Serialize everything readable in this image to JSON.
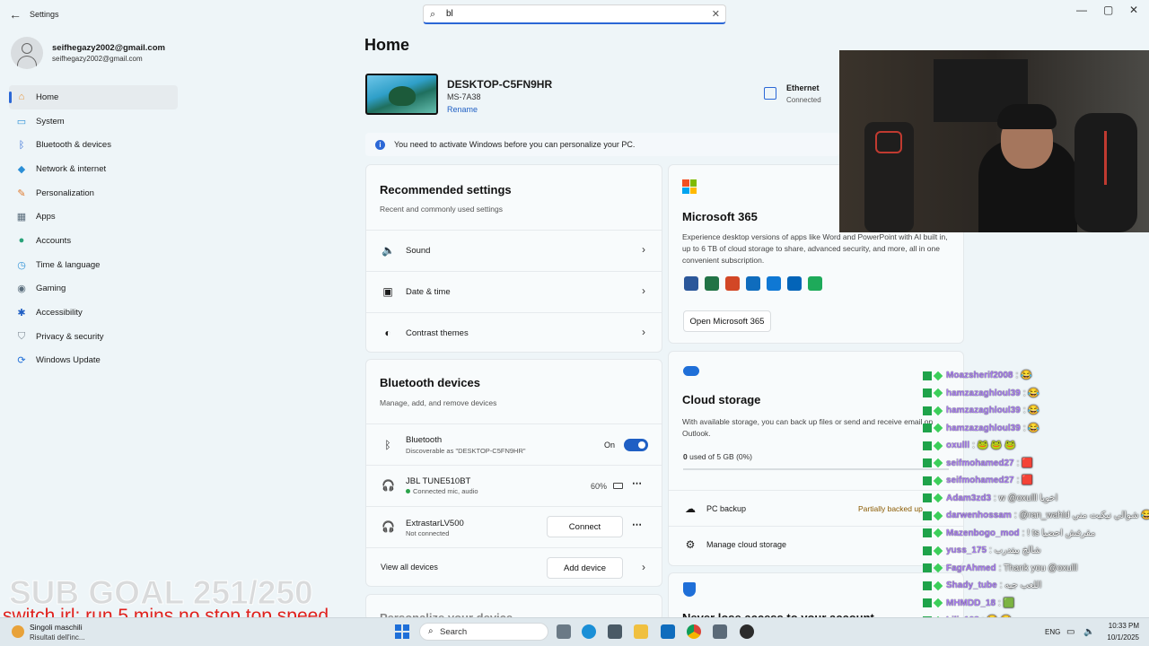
{
  "window": {
    "title": "Settings",
    "search_value": "bl",
    "minimize": "—",
    "maximize": "▢",
    "close": "✕"
  },
  "user": {
    "name": "seifhegazy2002@gmail.com",
    "email": "seifhegazy2002@gmail.com"
  },
  "sidebar": {
    "items": [
      {
        "label": "Home",
        "icon": "home-icon",
        "color": "#e8953a"
      },
      {
        "label": "System",
        "icon": "monitor-icon",
        "color": "#2b8fd6"
      },
      {
        "label": "Bluetooth & devices",
        "icon": "bluetooth-icon",
        "color": "#2b67d6"
      },
      {
        "label": "Network & internet",
        "icon": "wifi-icon",
        "color": "#2b8fd6"
      },
      {
        "label": "Personalization",
        "icon": "brush-icon",
        "color": "#e07a2e"
      },
      {
        "label": "Apps",
        "icon": "apps-icon",
        "color": "#5a6d7c"
      },
      {
        "label": "Accounts",
        "icon": "person-icon",
        "color": "#2aa37a"
      },
      {
        "label": "Time & language",
        "icon": "globe-clock-icon",
        "color": "#2b8fd6"
      },
      {
        "label": "Gaming",
        "icon": "controller-icon",
        "color": "#5a6d7c"
      },
      {
        "label": "Accessibility",
        "icon": "accessibility-icon",
        "color": "#1f5fc4"
      },
      {
        "label": "Privacy & security",
        "icon": "shield-icon",
        "color": "#7a8691"
      },
      {
        "label": "Windows Update",
        "icon": "update-icon",
        "color": "#1f6fd8"
      }
    ]
  },
  "home": {
    "title": "Home",
    "device_name": "DESKTOP-C5FN9HR",
    "device_model": "MS-7A38",
    "rename": "Rename",
    "network_label": "Ethernet",
    "network_status": "Connected",
    "activation_notice": "You need to activate Windows before you can personalize your PC."
  },
  "recommended": {
    "title": "Recommended settings",
    "subtitle": "Recent and commonly used settings",
    "items": [
      {
        "label": "Sound",
        "icon": "speaker-icon"
      },
      {
        "label": "Date & time",
        "icon": "calendar-clock-icon"
      },
      {
        "label": "Contrast themes",
        "icon": "contrast-icon"
      }
    ]
  },
  "bluetooth": {
    "title": "Bluetooth devices",
    "subtitle": "Manage, add, and remove devices",
    "bt_label": "Bluetooth",
    "bt_sub": "Discoverable as \"DESKTOP-C5FN9HR\"",
    "bt_state": "On",
    "dev1_name": "JBL TUNE510BT",
    "dev1_status": "Connected mic, audio",
    "dev1_battery": "60%",
    "dev2_name": "ExtrastarLV500",
    "dev2_status": "Not connected",
    "connect": "Connect",
    "view_all": "View all devices",
    "add_device": "Add device"
  },
  "personalize_partial": "Personalize your device",
  "m365": {
    "title": "Microsoft 365",
    "desc": "Experience desktop versions of apps like Word and PowerPoint with AI built in, up to 6 TB of cloud storage to share, advanced security, and more, all in one convenient subscription.",
    "open_button": "Open Microsoft 365",
    "logo_colors": [
      "#f25022",
      "#7fba00",
      "#00a4ef",
      "#ffb900"
    ],
    "app_icon_colors": [
      "#2b579a",
      "#217346",
      "#d24726",
      "#0f6cbd",
      "#0f78d4",
      "#0364b8",
      "#1eaa5a"
    ]
  },
  "cloud": {
    "title": "Cloud storage",
    "desc": "With available storage, you can back up files or send and receive email on Outlook.",
    "used_bold": "0",
    "used_rest": " used of 5 GB (0%)",
    "pc_backup": "PC backup",
    "pc_backup_status": "Partially backed up",
    "manage": "Manage cloud storage"
  },
  "security_partial": "Never lose access to your account",
  "stream": {
    "sub_goal": "SUB GOAL 251/250",
    "switch_irl": "switch irl: run 5 mins no stop top speed"
  },
  "chat": [
    {
      "user": "Moazsherif2008",
      "msg": ": 😂"
    },
    {
      "user": "hamzazaghloul39",
      "msg": ": 😂"
    },
    {
      "user": "hamzazaghloul39",
      "msg": ": 😂"
    },
    {
      "user": "hamzazaghloul39",
      "msg": ": 😂"
    },
    {
      "user": "oxulll",
      "msg": ": 🐸 🐸 🐸"
    },
    {
      "user": "seifmohamed27",
      "msg": ": 🟥"
    },
    {
      "user": "seifmohamed27",
      "msg": ": 🟥"
    },
    {
      "user": "Adam3zd3",
      "msg": ": w @oxulll اخويا"
    },
    {
      "user": "darwenhossam",
      "msg": ": @ran_wahid شوالي نيكيت مني 😂"
    },
    {
      "user": "Mazenbogo_mod",
      "msg": ": ! ts مقرفش احضيا"
    },
    {
      "user": "yuss_175",
      "msg": ": شالخ بيتدرب"
    },
    {
      "user": "FagrAhmed",
      "msg": ": Thank you @oxulll"
    },
    {
      "user": "Shady_tube",
      "msg": ": اللعب جيه"
    },
    {
      "user": "MHMDD_18",
      "msg": ": 🟩"
    },
    {
      "user": "Lili_108",
      "msg": ": 😂 😂"
    }
  ],
  "taskbar": {
    "notif_title": "Singoli maschili",
    "notif_sub": "Risultati dell'inc...",
    "search": "Search",
    "lang": "ENG",
    "time": "10:33 PM",
    "date": "10/1/2025"
  }
}
